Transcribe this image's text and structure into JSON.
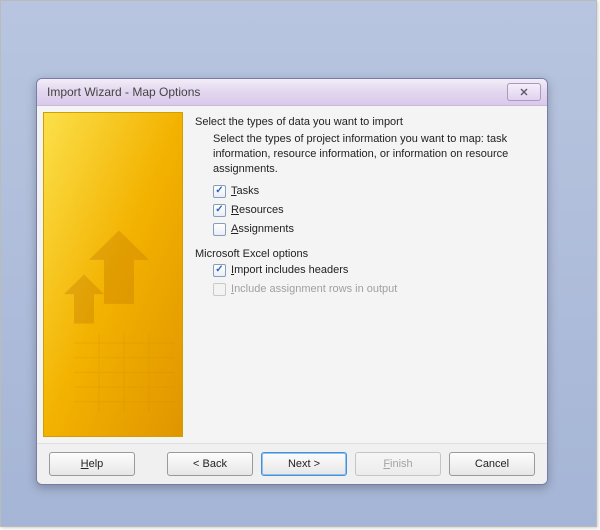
{
  "window": {
    "title": "Import Wizard - Map Options"
  },
  "content": {
    "section1_title": "Select the types of data you want to import",
    "section1_sub": "Select the types of project information you want to map: task information, resource information, or information on resource assignments.",
    "opt_tasks": "Tasks",
    "opt_resources": "Resources",
    "opt_assignments": "Assignments",
    "section2_title": "Microsoft Excel options",
    "opt_import_headers": "Import includes headers",
    "opt_include_rows": "Include assignment rows in output"
  },
  "state": {
    "tasks_checked": true,
    "resources_checked": true,
    "assignments_checked": false,
    "headers_checked": true,
    "include_rows_checked": false,
    "include_rows_enabled": false
  },
  "buttons": {
    "help": "Help",
    "back": "< Back",
    "next": "Next >",
    "finish": "Finish",
    "cancel": "Cancel"
  }
}
